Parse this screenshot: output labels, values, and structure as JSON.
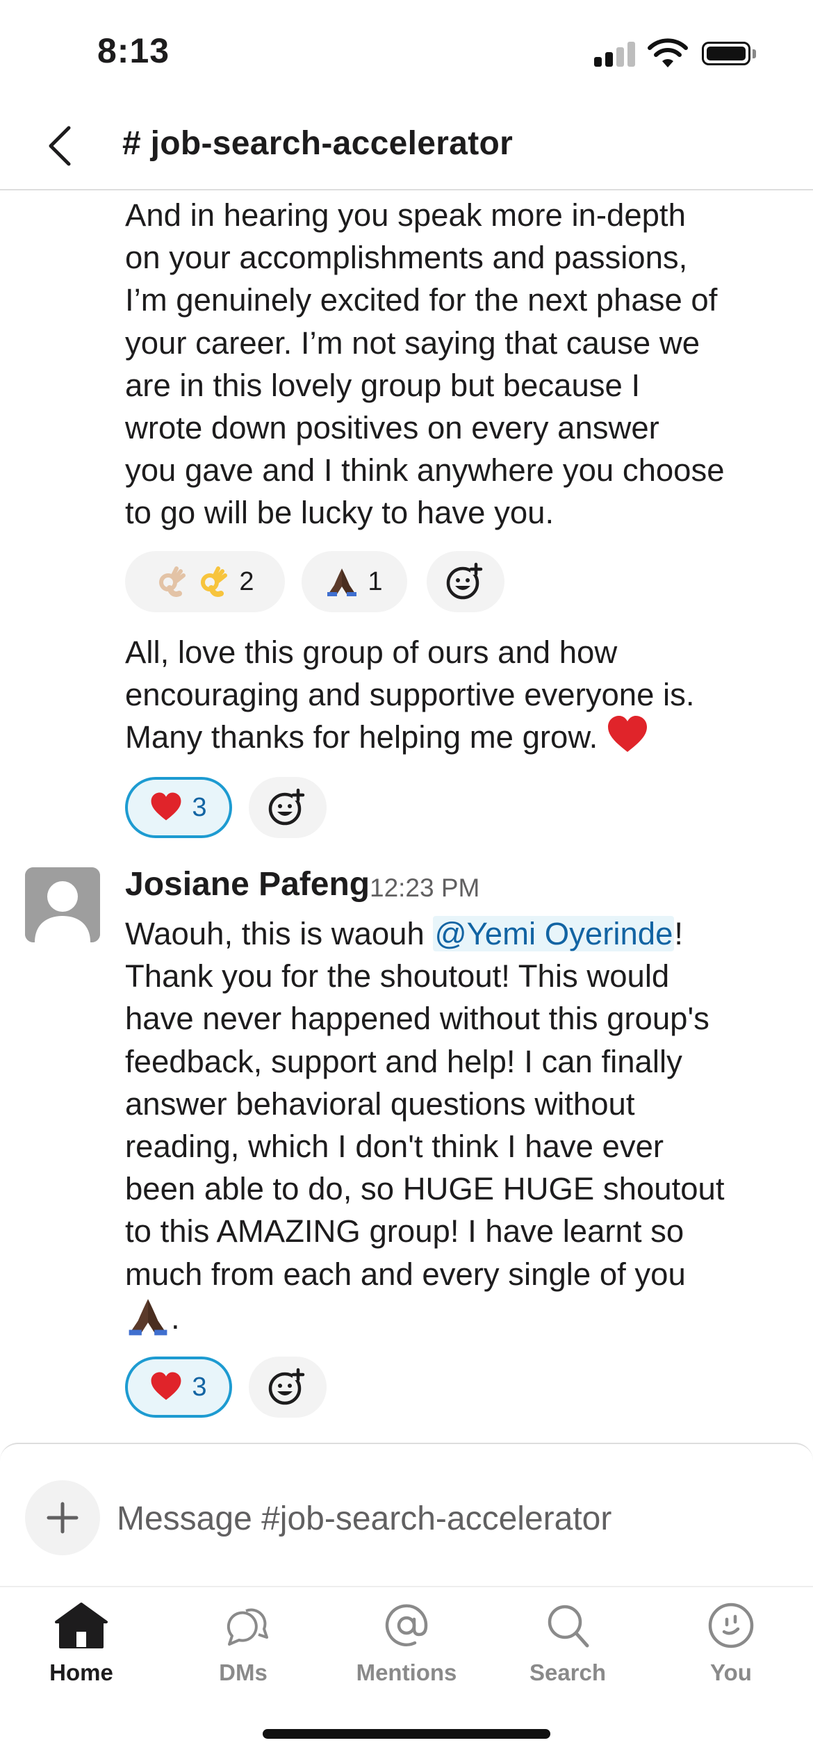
{
  "status_bar": {
    "time": "8:13"
  },
  "header": {
    "channel_title": "# job-search-accelerator"
  },
  "messages": {
    "first": {
      "lines": [
        "And in hearing you speak more in-depth",
        "on your accomplishments and passions,",
        "I’m genuinely excited for the next phase of",
        "your career. I’m not saying that cause we",
        "are in this lovely group but because I",
        "wrote down positives on every answer",
        "you gave and I think anywhere you choose",
        "to go will be lucky to have you."
      ],
      "reactions": [
        {
          "emoji": "ok-hand-light-and-ok-hand",
          "count": "2"
        },
        {
          "emoji": "folded-hands-dark",
          "count": "1"
        }
      ]
    },
    "second": {
      "lines": [
        "All, love this group of ours and how",
        "encouraging and supportive everyone is.",
        "Many thanks for helping me grow."
      ],
      "reactions": [
        {
          "emoji": "red-heart",
          "count": "3"
        }
      ]
    },
    "third": {
      "author": "Josiane Pafeng",
      "time": "12:23 PM",
      "line_first_before": "Waouh, this is waouh ",
      "mention": "@Yemi Oyerinde",
      "line_first_after": "!",
      "lines": [
        "Thank you for the shoutout! This would",
        "have never happened without this group's",
        "feedback, support and help! I can finally",
        "answer behavioral questions without",
        "reading, which I don't think I have ever",
        "been able to do, so HUGE HUGE shoutout",
        "to this AMAZING group! I have learnt so",
        "much from each and every single of you"
      ],
      "last_line_suffix": ".",
      "reactions": [
        {
          "emoji": "red-heart",
          "count": "3"
        }
      ]
    }
  },
  "composer": {
    "placeholder": "Message #job-search-accelerator"
  },
  "tabs": [
    {
      "label": "Home",
      "icon": "home-icon"
    },
    {
      "label": "DMs",
      "icon": "dms-icon"
    },
    {
      "label": "Mentions",
      "icon": "mentions-icon"
    },
    {
      "label": "Search",
      "icon": "search-icon"
    },
    {
      "label": "You",
      "icon": "you-icon"
    }
  ],
  "colors": {
    "mention": "#1264a3",
    "reaction_active_border": "#1d9bd1",
    "reaction_active_bg": "#e8f5fa"
  }
}
